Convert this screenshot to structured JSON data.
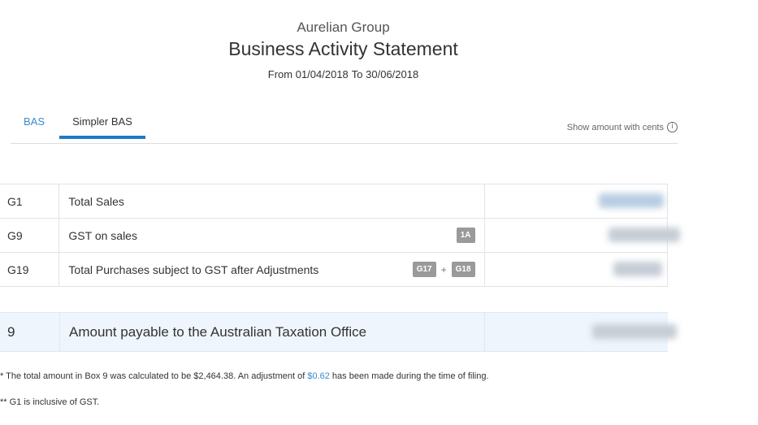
{
  "header": {
    "org_name": "Aurelian Group",
    "title": "Business Activity Statement",
    "period_from": "From 01/04/2018",
    "period_to": "To 30/06/2018"
  },
  "tabs": [
    {
      "label": "BAS",
      "active": false
    },
    {
      "label": "Simpler BAS",
      "active": true
    }
  ],
  "options": {
    "show_cents_label": "Show amount with cents",
    "info_icon": "i"
  },
  "rows": [
    {
      "code": "G1",
      "label": "Total Sales",
      "badges": [],
      "amount_hidden": true
    },
    {
      "code": "G9",
      "label": "GST on sales",
      "badges": [
        "1A"
      ],
      "amount_hidden": true
    },
    {
      "code": "G19",
      "label": "Total Purchases subject to GST after Adjustments",
      "badges": [
        "G17",
        "G18"
      ],
      "badge_joiner": "+",
      "amount_hidden": true
    }
  ],
  "total": {
    "code": "9",
    "label": "Amount payable to the Australian Taxation Office",
    "amount_hidden": true
  },
  "notes": {
    "note1_prefix": "* The total amount in Box 9 was calculated to be $2,464.38. An adjustment of ",
    "note1_link": "$0.62",
    "note1_suffix": " has been made during the time of filing.",
    "note2": "** G1 is inclusive of GST."
  },
  "colors": {
    "accent": "#1e7bc4",
    "link": "#3a8ac9",
    "badge": "#9a9a9a",
    "total_bg": "#eef5fc"
  }
}
